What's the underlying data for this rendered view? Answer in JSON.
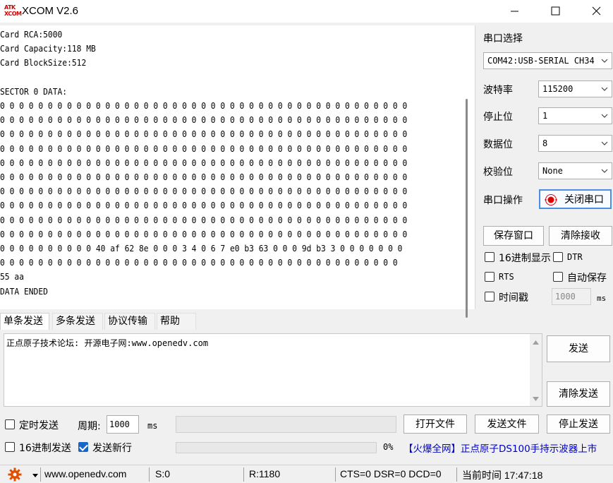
{
  "window": {
    "logo_top": "ATK",
    "logo_bottom": "XCOM",
    "title": "XCOM V2.6"
  },
  "receive": {
    "lines": [
      "Card RCA:5000",
      "Card Capacity:118 MB",
      "Card BlockSize:512",
      "",
      "SECTOR 0 DATA:",
      "0 0 0 0 0 0 0 0 0 0 0 0 0 0 0 0 0 0 0 0 0 0 0 0 0 0 0 0 0 0 0 0 0 0 0 0 0 0 0 0 0 0 0",
      "0 0 0 0 0 0 0 0 0 0 0 0 0 0 0 0 0 0 0 0 0 0 0 0 0 0 0 0 0 0 0 0 0 0 0 0 0 0 0 0 0 0 0",
      "0 0 0 0 0 0 0 0 0 0 0 0 0 0 0 0 0 0 0 0 0 0 0 0 0 0 0 0 0 0 0 0 0 0 0 0 0 0 0 0 0 0 0",
      "0 0 0 0 0 0 0 0 0 0 0 0 0 0 0 0 0 0 0 0 0 0 0 0 0 0 0 0 0 0 0 0 0 0 0 0 0 0 0 0 0 0 0",
      "0 0 0 0 0 0 0 0 0 0 0 0 0 0 0 0 0 0 0 0 0 0 0 0 0 0 0 0 0 0 0 0 0 0 0 0 0 0 0 0 0 0 0",
      "0 0 0 0 0 0 0 0 0 0 0 0 0 0 0 0 0 0 0 0 0 0 0 0 0 0 0 0 0 0 0 0 0 0 0 0 0 0 0 0 0 0 0",
      "0 0 0 0 0 0 0 0 0 0 0 0 0 0 0 0 0 0 0 0 0 0 0 0 0 0 0 0 0 0 0 0 0 0 0 0 0 0 0 0 0 0 0",
      "0 0 0 0 0 0 0 0 0 0 0 0 0 0 0 0 0 0 0 0 0 0 0 0 0 0 0 0 0 0 0 0 0 0 0 0 0 0 0 0 0 0 0",
      "0 0 0 0 0 0 0 0 0 0 0 0 0 0 0 0 0 0 0 0 0 0 0 0 0 0 0 0 0 0 0 0 0 0 0 0 0 0 0 0 0 0 0",
      "0 0 0 0 0 0 0 0 0 0 0 0 0 0 0 0 0 0 0 0 0 0 0 0 0 0 0 0 0 0 0 0 0 0 0 0 0 0 0 0 0 0 0",
      "0 0 0 0 0 0 0 0 0 0 40 af 62 8e 0 0 0 3 4 0 6 7 e0 b3 63 0 0 0 9d b3 3 0 0 0 0 0 0 0",
      "0 0 0 0 0 0 0 0 0 0 0 0 0 0 0 0 0 0 0 0 0 0 0 0 0 0 0 0 0 0 0 0 0 0 0 0 0 0 0 0 0 0",
      "55 aa",
      "DATA ENDED"
    ]
  },
  "settings": {
    "port_select_label": "串口选择",
    "port_value": "COM42:USB-SERIAL CH34",
    "baud_label": "波特率",
    "baud_value": "115200",
    "stopbits_label": "停止位",
    "stopbits_value": "1",
    "databits_label": "数据位",
    "databits_value": "8",
    "parity_label": "校验位",
    "parity_value": "None",
    "port_op_label": "串口操作",
    "close_port_label": "关闭串口",
    "save_window_label": "保存窗口",
    "clear_receive_label": "清除接收",
    "hex_display_label": "16进制显示",
    "dtr_label": "DTR",
    "rts_label": "RTS",
    "auto_save_label": "自动保存",
    "timestamp_label": "时间戳",
    "timestamp_placeholder": "1000",
    "ms_label": "ms"
  },
  "tabs": [
    "单条发送",
    "多条发送",
    "协议传输",
    "帮助"
  ],
  "send": {
    "text": "正点原子技术论坛: 开源电子网:www.openedv.com",
    "send_label": "发送",
    "clear_send_label": "清除发送",
    "timed_send_label": "定时发送",
    "period_label": "周期:",
    "period_value": "1000",
    "period_unit": "ms",
    "open_file_label": "打开文件",
    "send_file_label": "发送文件",
    "stop_send_label": "停止发送",
    "hex_send_label": "16进制发送",
    "newline_label": "发送新行",
    "progress_text": "0%",
    "progress_value": 0,
    "ad_text": "【火爆全网】正点原子DS100手持示波器上市"
  },
  "status": {
    "website": "www.openedv.com",
    "sent": "S:0",
    "received": "R:1180",
    "lines": "CTS=0 DSR=0 DCD=0",
    "time": "当前时间 17:47:18"
  },
  "colors": {
    "ad_text": "#0000cc",
    "close_port_indicator": "#e00000",
    "gear": "#e05000",
    "checkbox_checked": "#1a64c4"
  }
}
